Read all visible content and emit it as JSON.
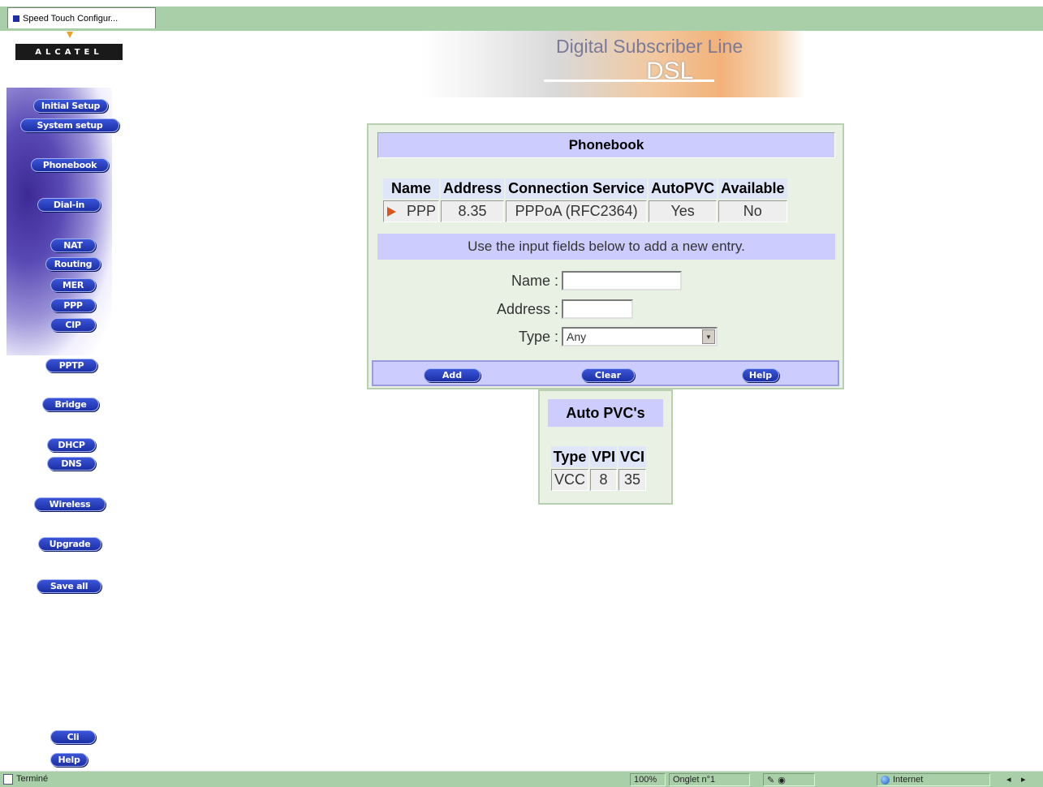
{
  "browser": {
    "tab_title": "Speed Touch Configur...",
    "status_text": "Terminé",
    "zoom": "100%",
    "tab_info": "Onglet n°1",
    "zone": "Internet",
    "nav_left": "◂",
    "nav_right": "▸"
  },
  "brand": {
    "logo_text": "ALCATEL",
    "banner_title": "Digital Subscriber Line",
    "banner_sub": "DSL"
  },
  "sidebar": {
    "items": [
      {
        "label": "Initial Setup"
      },
      {
        "label": "System setup"
      },
      {
        "label": "Phonebook"
      },
      {
        "label": "Dial-in"
      },
      {
        "label": "NAT"
      },
      {
        "label": "Routing"
      },
      {
        "label": "MER"
      },
      {
        "label": "PPP"
      },
      {
        "label": "CIP"
      },
      {
        "label": "PPTP"
      },
      {
        "label": "Bridge"
      },
      {
        "label": "DHCP"
      },
      {
        "label": "DNS"
      },
      {
        "label": "Wireless"
      },
      {
        "label": "Upgrade"
      },
      {
        "label": "Save all"
      },
      {
        "label": "Cli"
      },
      {
        "label": "Help"
      }
    ]
  },
  "phonebook": {
    "title": "Phonebook",
    "columns": [
      "Name",
      "Address",
      "Connection Service",
      "AutoPVC",
      "Available"
    ],
    "rows": [
      {
        "name": "PPP",
        "address": "8.35",
        "service": "PPPoA (RFC2364)",
        "autopvc": "Yes",
        "available": "No"
      }
    ],
    "hint": "Use the input fields below to add a new entry.",
    "form": {
      "name_label": "Name :",
      "name_value": "",
      "address_label": "Address :",
      "address_value": "",
      "type_label": "Type :",
      "type_value": "Any"
    },
    "buttons": {
      "add": "Add",
      "clear": "Clear",
      "help": "Help"
    }
  },
  "auto_pvc": {
    "title": "Auto PVC's",
    "columns": [
      "Type",
      "VPI",
      "VCI"
    ],
    "rows": [
      {
        "type": "VCC",
        "vpi": "8",
        "vci": "35"
      }
    ]
  },
  "colors": {
    "accent_green": "#a9cfa9",
    "panel_header": "#ccccff",
    "nav_button": "#1c2fa5",
    "arrow": "#d9561b"
  }
}
